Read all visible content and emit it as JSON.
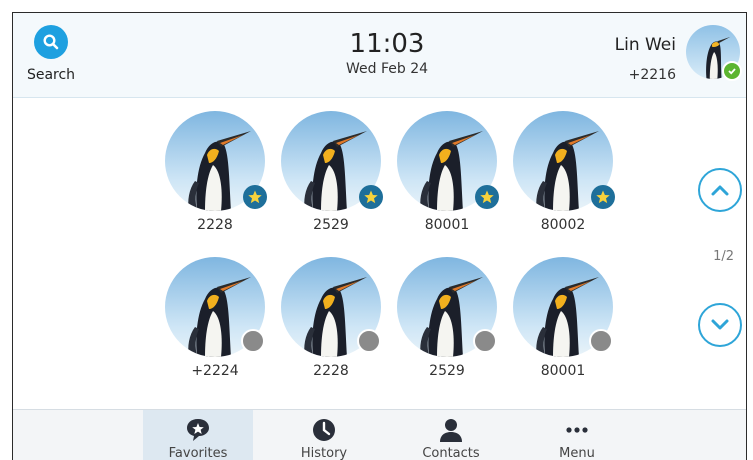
{
  "header": {
    "search_label": "Search",
    "time": "11:03",
    "date": "Wed Feb 24",
    "user_name": "Lin Wei",
    "user_ext": "+2216"
  },
  "favorites": [
    {
      "label": "2228",
      "badge": "star"
    },
    {
      "label": "2529",
      "badge": "star"
    },
    {
      "label": "80001",
      "badge": "star"
    },
    {
      "label": "80002",
      "badge": "star"
    },
    {
      "label": "+2224",
      "badge": "status-grey"
    },
    {
      "label": "2228",
      "badge": "status-grey"
    },
    {
      "label": "2529",
      "badge": "status-grey"
    },
    {
      "label": "80001",
      "badge": "status-grey"
    }
  ],
  "pager": {
    "indicator": "1/2"
  },
  "tabs": [
    {
      "label": "Favorites",
      "icon": "favorites-icon",
      "active": true
    },
    {
      "label": "History",
      "icon": "clock-icon",
      "active": false
    },
    {
      "label": "Contacts",
      "icon": "person-icon",
      "active": false
    },
    {
      "label": "Menu",
      "icon": "more-dots-icon",
      "active": false
    }
  ],
  "colors": {
    "accent": "#1ea0e0",
    "status_green": "#5cb531",
    "star_badge": "#1e6f9a"
  }
}
